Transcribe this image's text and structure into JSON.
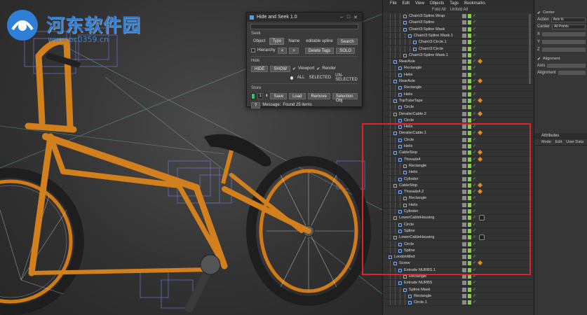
{
  "watermark": {
    "title": "河东软件园",
    "url": "www.pc0359.cn"
  },
  "dialog": {
    "title": "Hide and Seek 1.0",
    "search_value": "",
    "seek_label": "Seek",
    "seek_options": [
      "Object",
      "Type",
      "Name",
      "editable spline",
      "Search"
    ],
    "hierarchy_label": "Hierarchy",
    "hierarchy_prev": "<",
    "hierarchy_next": ">",
    "delete_tags_label": "Delete Tags",
    "solo_label": "SOLO",
    "hide_label": "Hide",
    "hide_button": "HIDE",
    "show_button": "SHOW",
    "viewport_label": "Viewport",
    "render_label": "Render",
    "scope_all": "ALL",
    "scope_selected": "SELECTED",
    "scope_unselected": "UN-SELECTED",
    "store_label": "Store",
    "store_number": "1",
    "save_label": "Save",
    "load_label": "Load",
    "remove_label": "Remove",
    "selection_only_label": "Selection Obj",
    "message_label": "Message:",
    "message_value": "Found 25 items",
    "colors": {
      "store_swatch": "#3ec26a",
      "bg": "#3b3b3b"
    }
  },
  "object_manager": {
    "menu": [
      "File",
      "Edit",
      "View",
      "Objects",
      "Tags",
      "Bookmarks"
    ],
    "toolbar": [
      "Fold All",
      "Unfold All"
    ],
    "rows": [
      {
        "label": "Chain\\3:Spline.Wrap",
        "indent": 3,
        "tag": "none"
      },
      {
        "label": "Chain\\3:Spline",
        "indent": 3,
        "tag": "none"
      },
      {
        "label": "Chain\\3:Spline Mask",
        "indent": 3,
        "tag": "none"
      },
      {
        "label": "Chain\\3:Spline Mask.1",
        "indent": 4,
        "tag": "none"
      },
      {
        "label": "Chain\\3:Circle.1",
        "indent": 5,
        "tag": "none"
      },
      {
        "label": "Chain\\3:Circle",
        "indent": 5,
        "tag": "none"
      },
      {
        "label": "Chain\\3:Spline Mask.1",
        "indent": 3,
        "tag": "none"
      },
      {
        "label": "RearAxle",
        "indent": 1,
        "tag": "orange"
      },
      {
        "label": "Rectangle",
        "indent": 2,
        "tag": "none"
      },
      {
        "label": "Helix",
        "indent": 2,
        "tag": "none"
      },
      {
        "label": "RearAxle",
        "indent": 1,
        "tag": "orange"
      },
      {
        "label": "Rectangle",
        "indent": 2,
        "tag": "none"
      },
      {
        "label": "Helix",
        "indent": 2,
        "tag": "none"
      },
      {
        "label": "TopTubeTape",
        "indent": 1,
        "tag": "orange"
      },
      {
        "label": "Circle",
        "indent": 2,
        "tag": "none"
      },
      {
        "label": "DerailerCable.2",
        "indent": 1,
        "tag": "orange"
      },
      {
        "label": "Circle",
        "indent": 2,
        "tag": "none"
      },
      {
        "label": "Helix",
        "indent": 2,
        "tag": "none"
      },
      {
        "label": "DerailerCable.1",
        "indent": 1,
        "tag": "orange"
      },
      {
        "label": "Circle",
        "indent": 2,
        "tag": "none"
      },
      {
        "label": "Helix",
        "indent": 2,
        "tag": "none"
      },
      {
        "label": "CableStop",
        "indent": 1,
        "tag": "orange"
      },
      {
        "label": "Threads4",
        "indent": 2,
        "tag": "orange"
      },
      {
        "label": "Rectangle",
        "indent": 3,
        "tag": "none"
      },
      {
        "label": "Helix",
        "indent": 3,
        "tag": "none"
      },
      {
        "label": "Cylinder",
        "indent": 2,
        "tag": "none"
      },
      {
        "label": "CableStop",
        "indent": 1,
        "tag": "orange"
      },
      {
        "label": "Threads4.2",
        "indent": 2,
        "tag": "orange"
      },
      {
        "label": "Rectangle",
        "indent": 3,
        "tag": "none"
      },
      {
        "label": "Helix",
        "indent": 3,
        "tag": "none"
      },
      {
        "label": "Cylinder",
        "indent": 2,
        "tag": "none"
      },
      {
        "label": "LowerCableHousing",
        "indent": 1,
        "tag": "ball"
      },
      {
        "label": "Circle",
        "indent": 2,
        "tag": "none"
      },
      {
        "label": "Spline",
        "indent": 2,
        "tag": "none"
      },
      {
        "label": "LowerCableHousing",
        "indent": 1,
        "tag": "ball"
      },
      {
        "label": "Circle",
        "indent": 2,
        "tag": "none"
      },
      {
        "label": "Spline",
        "indent": 2,
        "tag": "none"
      },
      {
        "label": "LondonMed",
        "indent": 0,
        "tag": "none"
      },
      {
        "label": "Screw",
        "indent": 1,
        "tag": "dots"
      },
      {
        "label": "Extrude NURBS.1",
        "indent": 2,
        "tag": "none"
      },
      {
        "label": "Rectangle",
        "indent": 3,
        "tag": "none"
      },
      {
        "label": "Extrude NURBS",
        "indent": 2,
        "tag": "none"
      },
      {
        "label": "Spline Mask",
        "indent": 3,
        "tag": "none"
      },
      {
        "label": "Rectangle",
        "indent": 4,
        "tag": "none"
      },
      {
        "label": "Circle.1",
        "indent": 4,
        "tag": "none"
      }
    ]
  },
  "attributes": {
    "center_label": "Center",
    "action_label": "Action",
    "action_value": "Axis to",
    "center_label2": "Center",
    "center_value": "All Points",
    "x_label": "X",
    "y_label": "Y",
    "z_label": "Z",
    "alignment_label": "Alignment",
    "axis_label": "Axis",
    "alignment_label2": "Alignment",
    "panel_title": "Attributes",
    "menu": [
      "Mode",
      "Edit",
      "User Data"
    ]
  }
}
